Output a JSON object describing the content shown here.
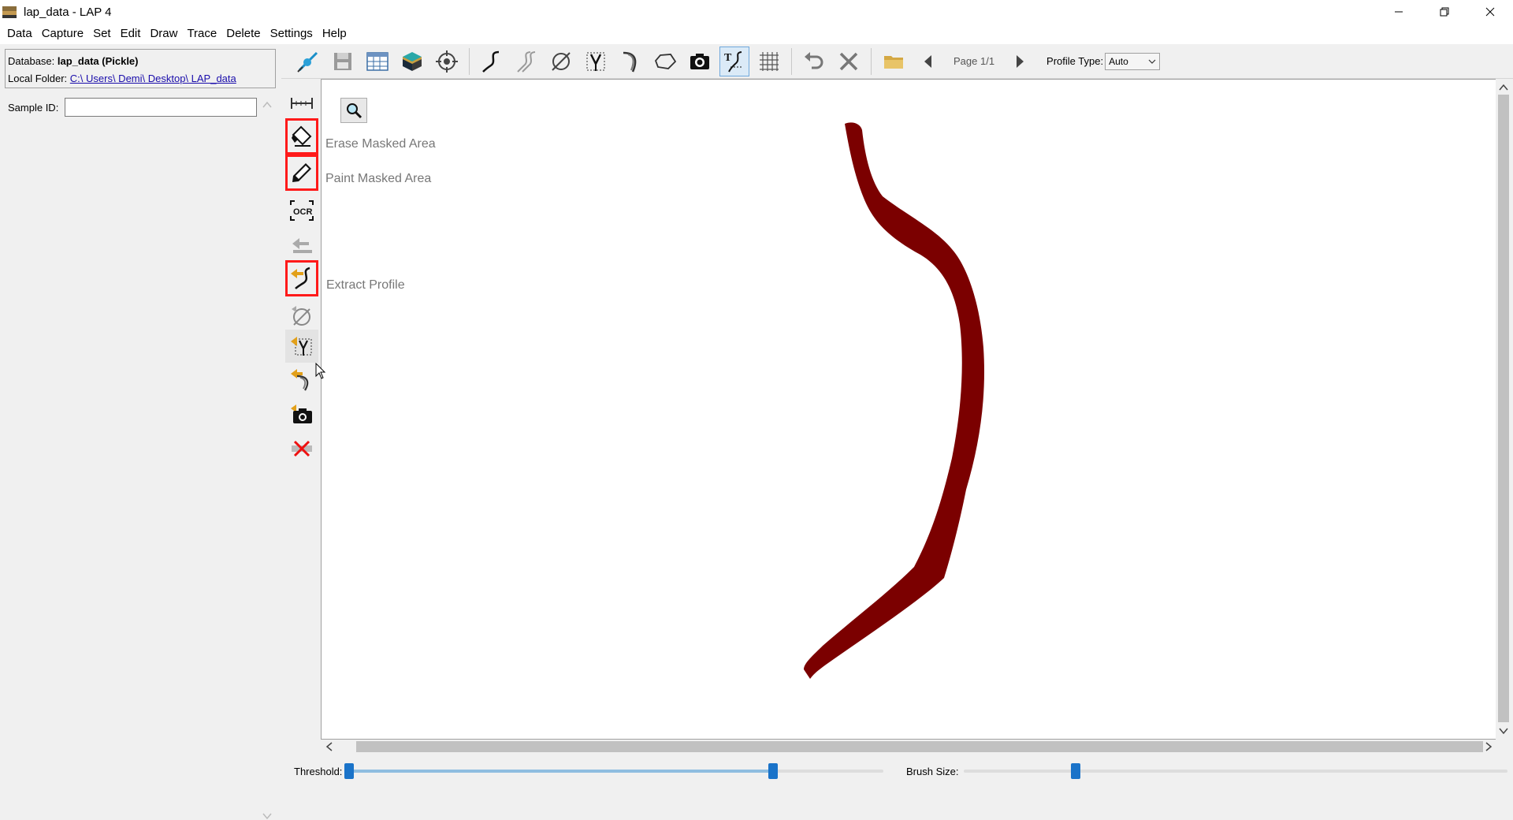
{
  "window": {
    "title": "lap_data - LAP 4",
    "minimize_icon": "minimize-icon",
    "maximize_icon": "restore-icon",
    "close_icon": "close-icon"
  },
  "menu": [
    "Data",
    "Capture",
    "Set",
    "Edit",
    "Draw",
    "Trace",
    "Delete",
    "Settings",
    "Help"
  ],
  "left_panel": {
    "database_label": "Database:",
    "database_value": "lap_data (Pickle)",
    "folder_label": "Local Folder:",
    "folder_value": "C:\\ Users\\ Demi\\ Desktop\\ LAP_data",
    "sample_id_label": "Sample ID:",
    "sample_id_value": ""
  },
  "toolbar": {
    "page_label": "Page 1/1",
    "profile_type_label": "Profile Type:",
    "profile_type_value": "Auto"
  },
  "canvas": {
    "tip_erase": "Erase Masked Area",
    "tip_paint": "Paint Masked Area",
    "tip_extract": "Extract Profile",
    "profile_color": "#7b0000"
  },
  "bottom": {
    "threshold_label": "Threshold:",
    "brush_size_label": "Brush Size:",
    "threshold_low": 0,
    "threshold_high": 0.8,
    "brush_size": 0.2
  },
  "colors": {
    "accent": "#1a73c9",
    "highlight": "#ff1a1a",
    "active_tool": "#6fa8dc"
  }
}
